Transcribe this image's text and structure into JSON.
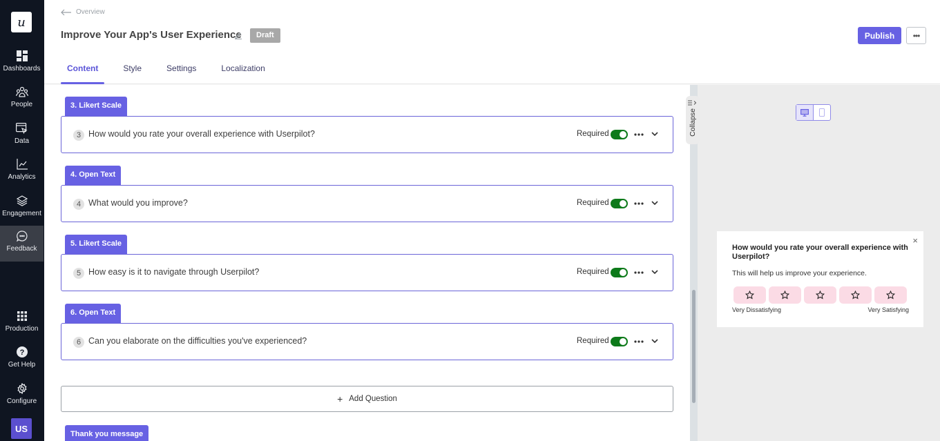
{
  "sidebar": {
    "logo": "u",
    "items": [
      {
        "label": "Dashboards",
        "icon": "dashboard-icon"
      },
      {
        "label": "People",
        "icon": "people-icon"
      },
      {
        "label": "Data",
        "icon": "data-icon"
      },
      {
        "label": "Analytics",
        "icon": "analytics-icon"
      },
      {
        "label": "Engagement",
        "icon": "layers-icon"
      },
      {
        "label": "Feedback",
        "icon": "chat-icon",
        "active": true
      }
    ],
    "bottom_items": [
      {
        "label": "Production",
        "icon": "grid-icon"
      },
      {
        "label": "Get Help",
        "icon": "help-icon"
      },
      {
        "label": "Configure",
        "icon": "gear-icon"
      }
    ],
    "avatar": "US"
  },
  "header": {
    "back_label": "Overview",
    "title": "Improve Your App's User Experience",
    "status": "Draft",
    "publish_label": "Publish",
    "more_label": "•••",
    "tabs": [
      {
        "label": "Content",
        "active": true
      },
      {
        "label": "Style"
      },
      {
        "label": "Settings"
      },
      {
        "label": "Localization"
      }
    ]
  },
  "questions": [
    {
      "tag": "3. Likert Scale",
      "number": "3",
      "text": "How would you rate your overall experience with Userpilot?",
      "required_label": "Required",
      "required": true
    },
    {
      "tag": "4. Open Text",
      "number": "4",
      "text": "What would you improve?",
      "required_label": "Required",
      "required": true
    },
    {
      "tag": "5. Likert Scale",
      "number": "5",
      "text": "How easy is it to navigate through Userpilot?",
      "required_label": "Required",
      "required": true
    },
    {
      "tag": "6. Open Text",
      "number": "6",
      "text": "Can you elaborate on the difficulties you've experienced?",
      "required_label": "Required",
      "required": true
    }
  ],
  "add_question_label": "Add Question",
  "thank_you_tag": "Thank you message",
  "preview": {
    "collapse_label": "Collapse",
    "device_modes": [
      "desktop",
      "mobile"
    ],
    "active_device": "desktop",
    "widget": {
      "title": "How would you rate your overall experience with Userpilot?",
      "subtitle": "This will help us improve your experience.",
      "scale_count": 5,
      "low_label": "Very Dissatisfying",
      "high_label": "Very Satisfying",
      "close": "×"
    }
  },
  "colors": {
    "accent": "#6761e3",
    "sidebar_bg": "#0f1521",
    "toggle_on": "#0d7a1a",
    "star_bg": "#fbdbe5"
  }
}
